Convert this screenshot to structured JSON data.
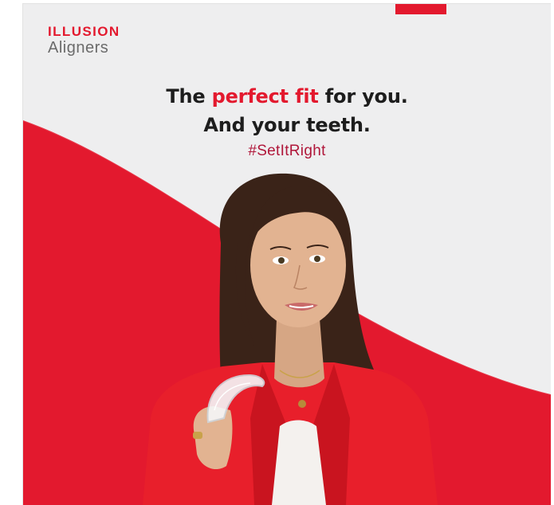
{
  "colors": {
    "accent": "#e3192e",
    "background": "#eeeeef",
    "headline": "#1d1d1d",
    "hashtag": "#b0173a"
  },
  "brand": {
    "line1": "ILLUSION",
    "line2": "Aligners"
  },
  "headline": {
    "part1": "The ",
    "highlight": "perfect fit",
    "part2": " for you.",
    "line2": "And your teeth."
  },
  "hashtag": "#SetItRight",
  "icons": [
    "aligner-tray-icon",
    "top-accent-bar"
  ]
}
